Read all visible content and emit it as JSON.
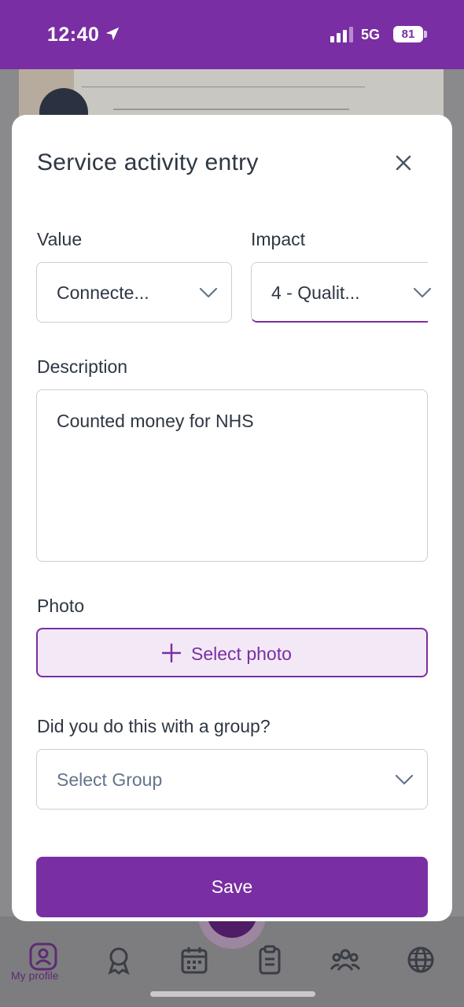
{
  "status_bar": {
    "time": "12:40",
    "network": "5G",
    "battery": "81"
  },
  "modal": {
    "title": "Service activity entry",
    "value": {
      "label": "Value",
      "selected": "Connecte..."
    },
    "impact": {
      "label": "Impact",
      "selected": "4 - Qualit..."
    },
    "description": {
      "label": "Description",
      "value": "Counted money for NHS"
    },
    "photo": {
      "label": "Photo",
      "button_label": "Select photo"
    },
    "group": {
      "label": "Did you do this with a group?",
      "placeholder": "Select Group"
    },
    "save_label": "Save"
  },
  "bottom_nav": {
    "items": [
      {
        "label": "My profile",
        "icon": "profile-icon"
      },
      {
        "label": "",
        "icon": "award-icon"
      },
      {
        "label": "",
        "icon": "calendar-icon"
      },
      {
        "label": "",
        "icon": "clipboard-icon"
      },
      {
        "label": "",
        "icon": "group-icon"
      },
      {
        "label": "",
        "icon": "globe-icon"
      }
    ]
  },
  "colors": {
    "brand": "#7a2ea3",
    "text": "#2e3742",
    "muted": "#64748b",
    "border": "#c9ced8"
  }
}
